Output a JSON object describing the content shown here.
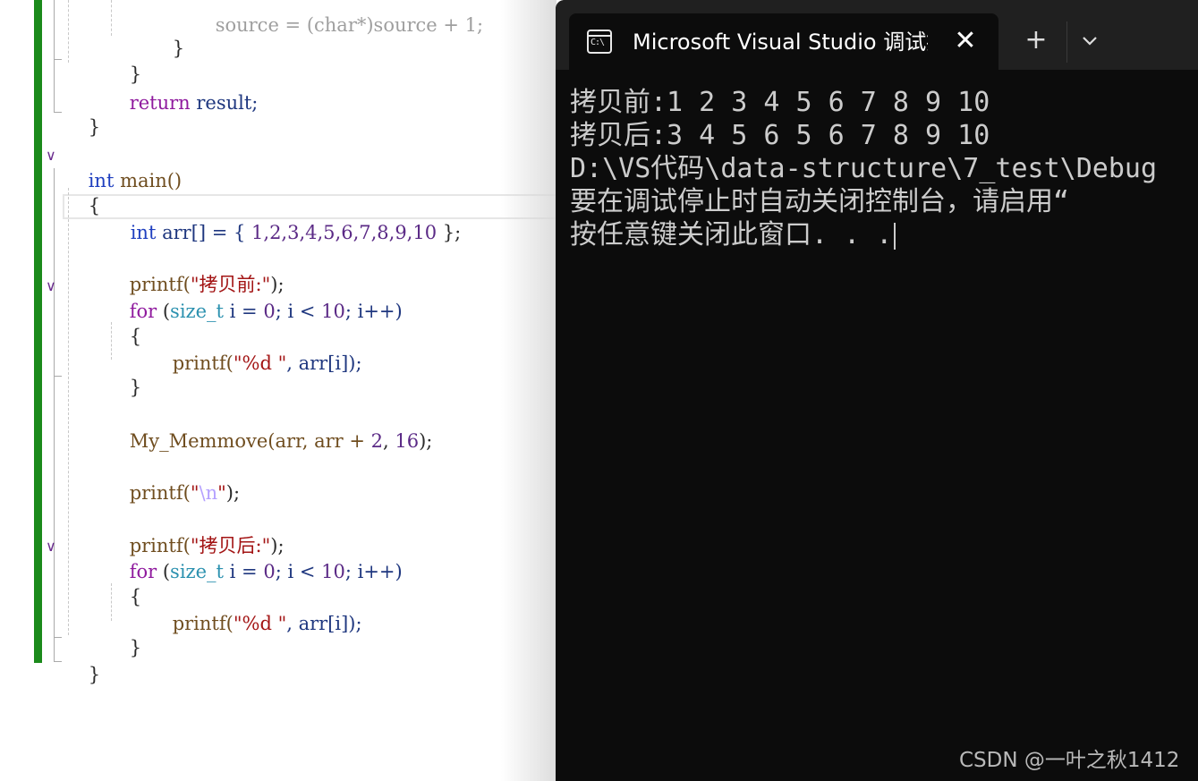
{
  "editor": {
    "lines": {
      "l0": "source = (char*)source + 1;",
      "l1": "}",
      "l2": "}",
      "l3a": "return",
      "l3b": " result;",
      "l4": "}",
      "l5a": "int",
      "l5b": " main()",
      "l6": "{",
      "l7a": "int",
      "l7b": " arr[] = { ",
      "l7c": "1,2,3,4,5,6,7,8,9,10",
      "l7d": " };",
      "l8a": "printf(",
      "l8b": "\"拷贝前:\"",
      "l8c": ");",
      "l9a": "for",
      "l9b": " (",
      "l9c": "size_t",
      "l9d": " i = ",
      "l9e": "0",
      "l9f": "; i < ",
      "l9g": "10",
      "l9h": "; i++)",
      "l10": "{",
      "l11a": "printf(",
      "l11b": "\"%d \"",
      "l11c": ", arr[i]);",
      "l12": "}",
      "l13a": "My_Memmove(arr, arr + ",
      "l13b": "2",
      "l13c": ", ",
      "l13d": "16",
      "l13e": ");",
      "l14a": "printf(",
      "l14b": "\"",
      "l14c": "\\n",
      "l14d": "\"",
      "l14e": ");",
      "l15a": "printf(",
      "l15b": "\"拷贝后:\"",
      "l15c": ");",
      "l16a": "for",
      "l16b": " (",
      "l16c": "size_t",
      "l16d": " i = ",
      "l16e": "0",
      "l16f": "; i < ",
      "l16g": "10",
      "l16h": "; i++)",
      "l17": "{",
      "l18a": "printf(",
      "l18b": "\"%d \"",
      "l18c": ", arr[i]);",
      "l19": "}",
      "l20": "}"
    }
  },
  "terminal": {
    "tab_title": "Microsoft Visual Studio 调试控制台",
    "tab_icon_text": "C:\\",
    "close_glyph": "✕",
    "new_tab_glyph": "+",
    "output": [
      "拷贝前:1 2 3 4 5 6 7 8 9 10",
      "拷贝后:3 4 5 6 5 6 7 8 9 10",
      "D:\\VS代码\\data-structure\\7_test\\Debug",
      "要在调试停止时自动关闭控制台，请启用“",
      "按任意键关闭此窗口. . ."
    ]
  },
  "watermark": "CSDN @一叶之秋1412",
  "colors": {
    "keyword": "#1f3fbf",
    "control": "#8f1a9e",
    "type": "#2b91af",
    "string": "#a31515",
    "terminal_bg": "#0c0c0c",
    "titlebar_bg": "#202020",
    "change_bar": "#1b8a1b"
  }
}
